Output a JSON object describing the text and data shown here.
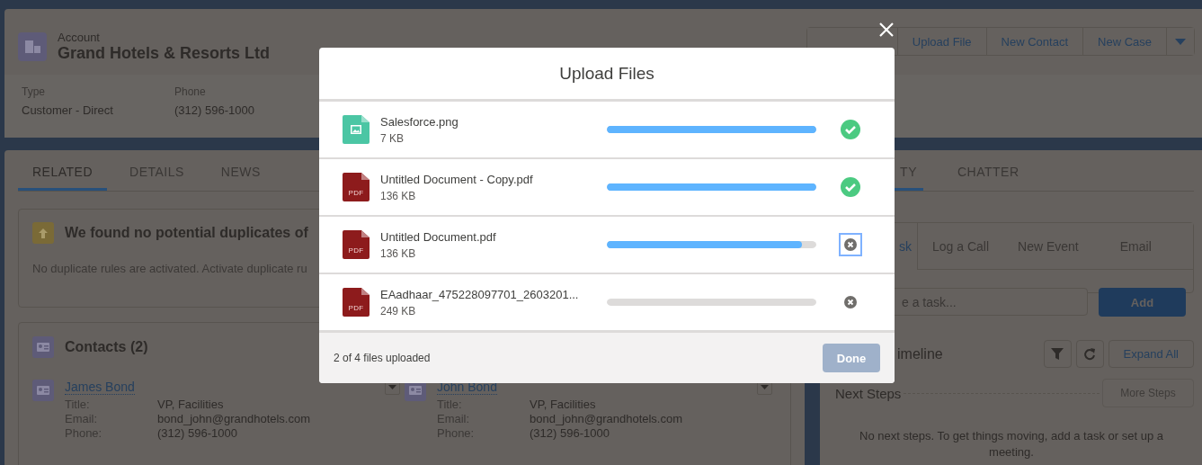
{
  "header": {
    "object_type": "Account",
    "title": "Grand Hotels & Resorts Ltd",
    "actions": [
      "Upload File",
      "New Contact",
      "New Case"
    ],
    "fields": [
      {
        "label": "Type",
        "value": "Customer - Direct"
      },
      {
        "label": "Phone",
        "value": "(312) 596-1000"
      }
    ]
  },
  "main_tabs": [
    {
      "label": "RELATED",
      "selected": true
    },
    {
      "label": "DETAILS",
      "selected": false
    },
    {
      "label": "NEWS",
      "selected": false
    }
  ],
  "duplicates": {
    "heading": "We found no potential duplicates of",
    "message": "No duplicate rules are activated. Activate duplicate ru"
  },
  "contacts": {
    "heading": "Contacts (2)",
    "items": [
      {
        "name": "James Bond",
        "fields": [
          {
            "label": "Title:",
            "value": "VP, Facilities"
          },
          {
            "label": "Email:",
            "value": "bond_john@grandhotels.com"
          },
          {
            "label": "Phone:",
            "value": "(312) 596-1000"
          }
        ]
      },
      {
        "name": "John Bond",
        "fields": [
          {
            "label": "Title:",
            "value": "VP, Facilities"
          },
          {
            "label": "Email:",
            "value": "bond_john@grandhotels.com"
          },
          {
            "label": "Phone:",
            "value": "(312) 596-1000"
          }
        ]
      }
    ]
  },
  "activity": {
    "tabs": [
      {
        "label": "TY",
        "selected": true
      },
      {
        "label": "CHATTER",
        "selected": false
      }
    ],
    "publisher_tabs": [
      {
        "label": "sk",
        "selected": true
      },
      {
        "label": "Log a Call",
        "selected": false
      },
      {
        "label": "New Event",
        "selected": false
      },
      {
        "label": "Email",
        "selected": false
      }
    ],
    "task_placeholder": "e a task...",
    "add_button": "Add",
    "timeline_title": "imeline",
    "expand_button": "Expand All",
    "next_steps": "Next Steps",
    "more_steps_button": "More Steps",
    "empty_message": "No next steps. To get things moving, add a task or set up a meeting."
  },
  "modal": {
    "title": "Upload Files",
    "files": [
      {
        "name": "Salesforce.png",
        "size": "7 KB",
        "kind": "image",
        "level": 1,
        "complete": true
      },
      {
        "name": "Untitled Document - Copy.pdf",
        "size": "136 KB",
        "kind": "pdf",
        "type_label": "PDF",
        "level": 1,
        "complete": true
      },
      {
        "name": "Untitled Document.pdf",
        "size": "136 KB",
        "kind": "pdf",
        "type_label": "PDF",
        "level": 0.93,
        "complete": false,
        "focused": true
      },
      {
        "name": "EAadhaar_475228097701_2603201...",
        "size": "249 KB",
        "kind": "pdf",
        "type_label": "PDF",
        "level": 0,
        "complete": false
      }
    ],
    "summary": "2 of 4 files uploaded",
    "done_button": {
      "label": "Done",
      "disabled": true
    }
  }
}
